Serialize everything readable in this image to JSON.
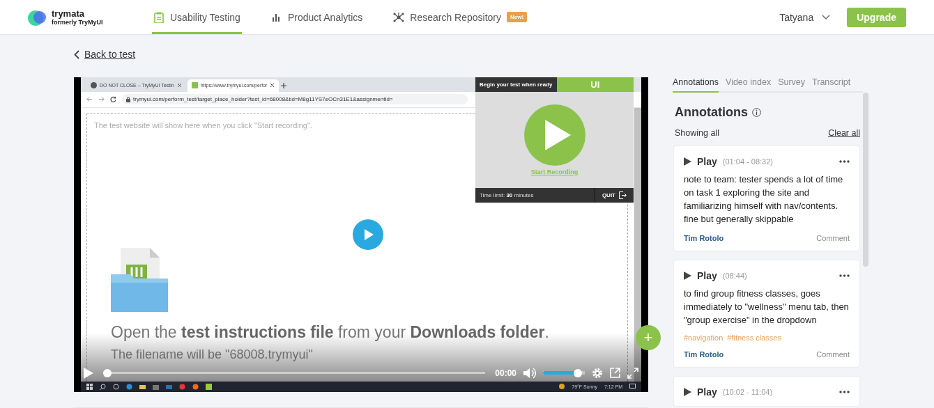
{
  "header": {
    "logo": {
      "name": "trymata",
      "subtitle": "formerly TryMyUI"
    },
    "nav": [
      {
        "label": "Usability Testing",
        "selected": true
      },
      {
        "label": "Product Analytics",
        "selected": false
      },
      {
        "label": "Research Repository",
        "selected": false,
        "badge": "New!"
      }
    ],
    "user": "Tatyana",
    "upgrade": "Upgrade"
  },
  "back_link": "Back to test",
  "video": {
    "screen": {
      "browser_tabs": [
        {
          "title": "DO NOT CLOSE – TryMyUI Testin",
          "selected": false
        },
        {
          "title": "https://www.trymyui.com/perfor",
          "selected": true
        }
      ],
      "url": "trymyui.com/perform_test/target_place_holder?test_id=68008&tid=M8g11YS7eOCn31E1&assignmentId=",
      "placeholder": "The test website will show here when you click \"Start recording\".",
      "overlay": {
        "title": "Begin your test when ready",
        "badge": "UI",
        "link": "Start Recording",
        "time_limit": "Time limit: **30** minutes",
        "quit": "QUIT"
      },
      "instructions": "Open the **test instructions file** from your **Downloads folder**.",
      "filename": "The filename will be \"68008.trymyui\"",
      "taskbar": {
        "weather": "79°F  Sunny",
        "time": "7:12 PM"
      }
    },
    "controls": {
      "time": "00:00",
      "progress": {
        "level": 0
      },
      "volume": {
        "level": 0.92
      }
    },
    "add_button": "+"
  },
  "panel": {
    "tabs": [
      {
        "label": "Annotations",
        "selected": true
      },
      {
        "label": "Video index",
        "selected": false
      },
      {
        "label": "Survey",
        "selected": false
      },
      {
        "label": "Transcript",
        "selected": false
      }
    ],
    "heading": "Annotations",
    "filter": "Showing all",
    "clear": "Clear all",
    "annotations": [
      {
        "play": "Play",
        "range": "(01:04 - 08:32)",
        "text": "note to team: tester spends a lot of time on task 1 exploring the site and familiarizing himself with nav/contents. fine but generally skippable",
        "author": "Tim Rotolo",
        "action": "Comment"
      },
      {
        "play": "Play",
        "range": "(08:44)",
        "text": "to find group fitness classes, goes immediately to \"wellness\" menu tab, then \"group exercise\" in the dropdown",
        "tags": [
          "#navigation",
          "#fitness classes"
        ],
        "author": "Tim Rotolo",
        "action": "Comment"
      },
      {
        "play": "Play",
        "range": "(10:02 - 11:04)"
      }
    ]
  }
}
